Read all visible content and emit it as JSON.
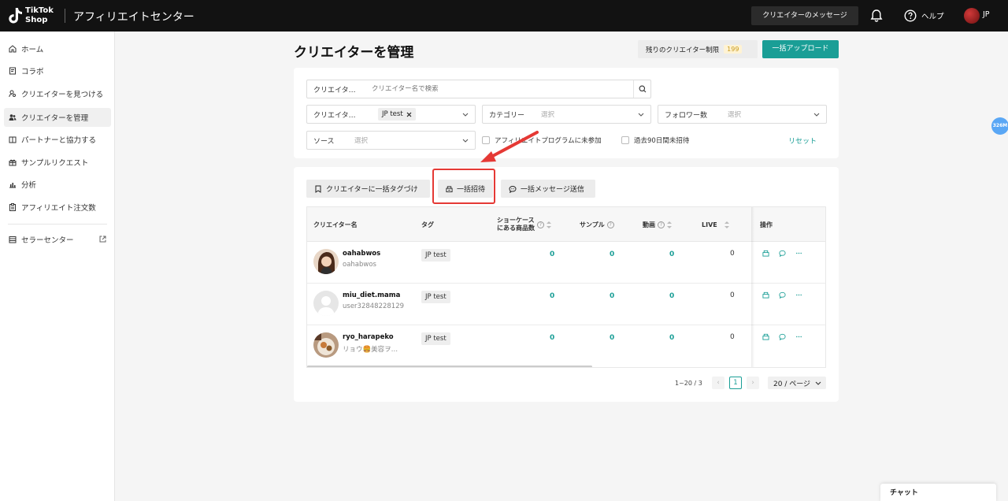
{
  "app": {
    "logo_line1": "TikTok",
    "logo_line2": "Shop",
    "title": "アフィリエイトセンター",
    "messages_button": "クリエイターのメッセージ",
    "help_label": "ヘルプ",
    "language": "JP"
  },
  "sidebar": {
    "items": [
      {
        "label": "ホーム",
        "icon": "home-icon"
      },
      {
        "label": "コラボ",
        "icon": "document-icon"
      },
      {
        "label": "クリエイターを見つける",
        "icon": "person-search-icon"
      },
      {
        "label": "クリエイターを管理",
        "icon": "people-icon",
        "active": true
      },
      {
        "label": "パートナーと協力する",
        "icon": "partner-icon"
      },
      {
        "label": "サンプルリクエスト",
        "icon": "gift-icon"
      },
      {
        "label": "分析",
        "icon": "chart-icon"
      },
      {
        "label": "アフィリエイト注文数",
        "icon": "clipboard-icon"
      }
    ],
    "seller_center": "セラーセンター"
  },
  "page": {
    "title": "クリエイターを管理",
    "limit_label": "残りのクリエイター制限",
    "limit_value": "199",
    "upload_button": "一括アップロード"
  },
  "filters": {
    "creator_search_label": "クリエイタ…",
    "creator_search_placeholder": "クリエイター名で検索",
    "creator_tag_label": "クリエイタ…",
    "creator_tag_value": "JP test",
    "category_label": "カテゴリー",
    "category_placeholder": "選択",
    "followers_label": "フォロワー数",
    "followers_placeholder": "選択",
    "source_label": "ソース",
    "source_placeholder": "選択",
    "checkbox_not_joined": "アフィリエイトプログラムに未参加",
    "checkbox_not_invited": "過去90日間未招待",
    "reset": "リセット"
  },
  "actions": {
    "bulk_tag": "クリエイターに一括タグづけ",
    "bulk_invite": "一括招待",
    "bulk_message": "一括メッセージ送信"
  },
  "table": {
    "headers": {
      "name": "クリエイター名",
      "tag": "タグ",
      "showcase_line1": "ショーケース",
      "showcase_line2": "にある商品数",
      "sample": "サンプル",
      "video": "動画",
      "live": "LIVE",
      "ops": "操作"
    },
    "rows": [
      {
        "name": "oahabwos",
        "sub": "oahabwos",
        "tag": "JP test",
        "showcase": "0",
        "sample": "0",
        "video": "0",
        "live": "0"
      },
      {
        "name": "miu_diet.mama",
        "sub": "user32848228129",
        "tag": "JP test",
        "showcase": "0",
        "sample": "0",
        "video": "0",
        "live": "0"
      },
      {
        "name": "ryo_harapeko",
        "sub": "リョウ🍔美容ヲ…",
        "tag": "JP test",
        "showcase": "0",
        "sample": "0",
        "video": "0",
        "live": "0"
      }
    ]
  },
  "pagination": {
    "info": "1~20 / 3",
    "current": "1",
    "page_size": "20 / ページ"
  },
  "float_badge": "326M",
  "chat": "チャット",
  "colors": {
    "accent": "#1a9e96",
    "topbar": "#121212",
    "highlight": "#e53935"
  }
}
